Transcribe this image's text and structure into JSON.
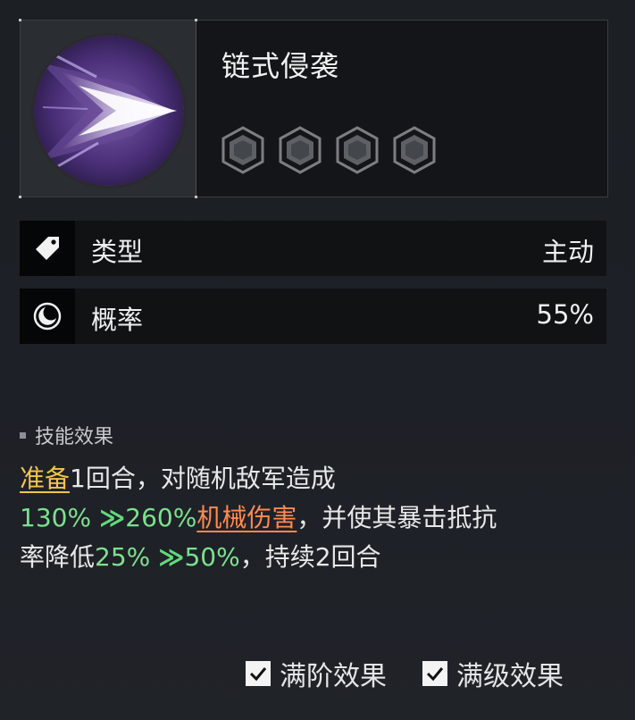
{
  "skill": {
    "name": "链式侵袭",
    "icon": "chevron-strike-icon",
    "stars": 4
  },
  "attributes": [
    {
      "icon": "tag-icon",
      "label": "类型",
      "value": "主动"
    },
    {
      "icon": "crescent-moon-icon",
      "label": "概率",
      "value": "55%"
    }
  ],
  "effects": {
    "title": "技能效果",
    "line1": {
      "keyword": "准备",
      "text": "1回合，对随机敌军造成"
    },
    "line2": {
      "from": "130%",
      "arrow": "≫",
      "to": "260%",
      "dmg_type": "机械伤害",
      "text": "，并使其暴击抵抗"
    },
    "line3": {
      "text": "率降低",
      "from": "25%",
      "arrow": "≫",
      "to": "50%",
      "end": "，持续2回合"
    }
  },
  "toggles": {
    "full_rank": "满阶效果",
    "full_level": "满级效果"
  },
  "colors": {
    "keyword": "#f4c44c",
    "upgrade": "#7de08f",
    "damage": "#ff8a4f"
  }
}
